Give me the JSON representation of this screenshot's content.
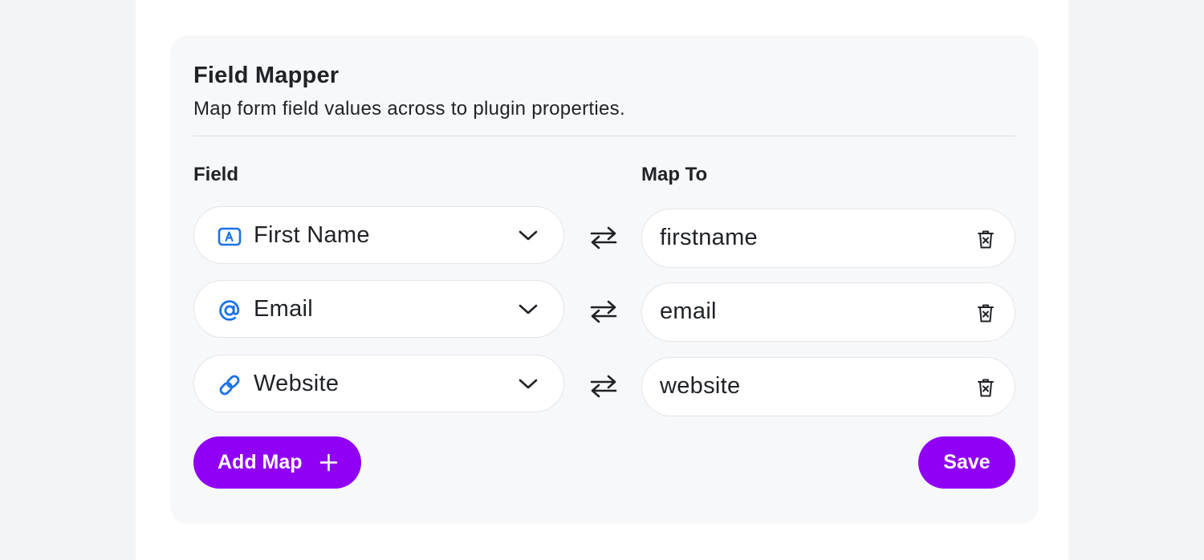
{
  "card": {
    "title": "Field Mapper",
    "description": "Map form field values across to plugin properties."
  },
  "columns": {
    "field_label": "Field",
    "map_label": "Map To"
  },
  "rows": [
    {
      "field": "First Name",
      "field_icon": "text-field-icon",
      "map_value": "firstname"
    },
    {
      "field": "Email",
      "field_icon": "at-sign-icon",
      "map_value": "email"
    },
    {
      "field": "Website",
      "field_icon": "link-icon",
      "map_value": "website"
    }
  ],
  "buttons": {
    "add_map_label": "Add Map",
    "save_label": "Save"
  },
  "colors": {
    "accent": "#9000f5",
    "icon_blue": "#1a73e8",
    "card_bg": "#f7f8fa",
    "page_bg": "#f3f4f6"
  }
}
